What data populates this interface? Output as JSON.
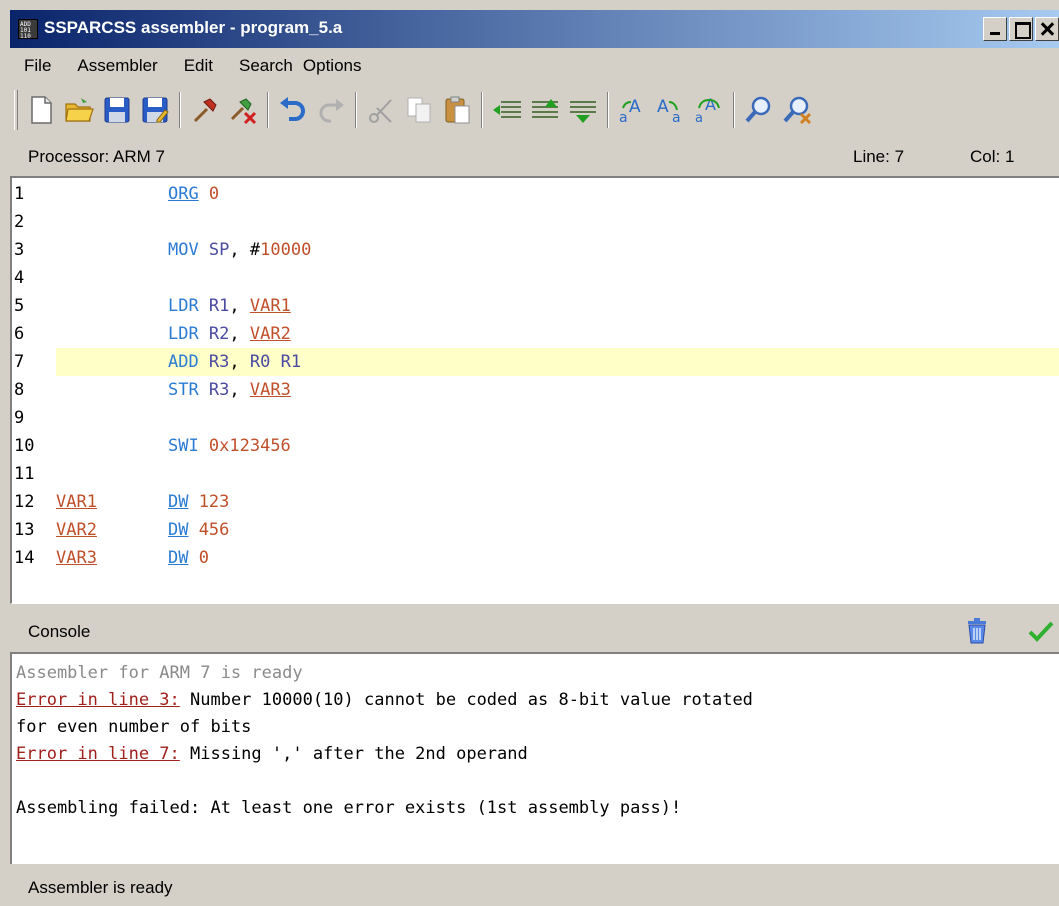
{
  "window": {
    "title": "SSPARCSS assembler - program_5.a",
    "app_icon_text": "ADD 101 110"
  },
  "menu": [
    "File",
    "Assembler",
    "Edit",
    "Search",
    "Options"
  ],
  "toolbar": {
    "icons": [
      "new-file-icon",
      "open-folder-icon",
      "save-icon",
      "save-as-icon",
      "assemble-icon",
      "clear-assemble-icon",
      "undo-icon",
      "redo-icon",
      "cut-icon",
      "copy-icon",
      "paste-icon",
      "indent-icon",
      "format-icon",
      "outdent-icon",
      "uppercase-icon",
      "lowercase-icon",
      "replace-case-icon",
      "find-icon",
      "find-replace-icon"
    ]
  },
  "info": {
    "processor": "Processor: ARM 7",
    "line": "Line: 7",
    "col": "Col: 1"
  },
  "editor": {
    "active_line": 7,
    "lines": [
      {
        "n": "1",
        "label": "",
        "op": "ORG",
        "op_kind": "dir",
        "args": [
          {
            "t": "0",
            "k": "num"
          }
        ]
      },
      {
        "n": "2",
        "label": "",
        "op": "",
        "op_kind": "",
        "args": []
      },
      {
        "n": "3",
        "label": "",
        "op": "MOV",
        "op_kind": "instr",
        "args": [
          {
            "t": "SP",
            "k": "reg"
          },
          {
            "t": ", ",
            "k": "punct"
          },
          {
            "t": "#",
            "k": "punct"
          },
          {
            "t": "10000",
            "k": "num"
          }
        ]
      },
      {
        "n": "4",
        "label": "",
        "op": "",
        "op_kind": "",
        "args": []
      },
      {
        "n": "5",
        "label": "",
        "op": "LDR",
        "op_kind": "instr",
        "args": [
          {
            "t": "R1",
            "k": "reg"
          },
          {
            "t": ", ",
            "k": "punct"
          },
          {
            "t": "VAR1",
            "k": "ref"
          }
        ]
      },
      {
        "n": "6",
        "label": "",
        "op": "LDR",
        "op_kind": "instr",
        "args": [
          {
            "t": "R2",
            "k": "reg"
          },
          {
            "t": ", ",
            "k": "punct"
          },
          {
            "t": "VAR2",
            "k": "ref"
          }
        ]
      },
      {
        "n": "7",
        "label": "",
        "op": "ADD",
        "op_kind": "instr",
        "args": [
          {
            "t": "R3",
            "k": "reg"
          },
          {
            "t": ", ",
            "k": "punct"
          },
          {
            "t": "R0",
            "k": "reg"
          },
          {
            "t": " ",
            "k": "punct"
          },
          {
            "t": "R1",
            "k": "reg"
          }
        ]
      },
      {
        "n": "8",
        "label": "",
        "op": "STR",
        "op_kind": "instr",
        "args": [
          {
            "t": "R3",
            "k": "reg"
          },
          {
            "t": ", ",
            "k": "punct"
          },
          {
            "t": "VAR3",
            "k": "ref"
          }
        ]
      },
      {
        "n": "9",
        "label": "",
        "op": "",
        "op_kind": "",
        "args": []
      },
      {
        "n": "10",
        "label": "",
        "op": "SWI",
        "op_kind": "instr",
        "args": [
          {
            "t": "0x123456",
            "k": "num"
          }
        ]
      },
      {
        "n": "11",
        "label": "",
        "op": "",
        "op_kind": "",
        "args": []
      },
      {
        "n": "12",
        "label": "VAR1",
        "op": "DW",
        "op_kind": "dir",
        "args": [
          {
            "t": "123",
            "k": "num"
          }
        ]
      },
      {
        "n": "13",
        "label": "VAR2",
        "op": "DW",
        "op_kind": "dir",
        "args": [
          {
            "t": "456",
            "k": "num"
          }
        ]
      },
      {
        "n": "14",
        "label": "VAR3",
        "op": "DW",
        "op_kind": "dir",
        "args": [
          {
            "t": "0",
            "k": "num"
          }
        ]
      }
    ]
  },
  "console": {
    "title": "Console",
    "lines": [
      [
        {
          "t": "Assembler for ARM 7 is ready",
          "k": "gray"
        }
      ],
      [
        {
          "t": "Error in line 3:",
          "k": "link"
        },
        {
          "t": " Number 10000(10) cannot be coded as 8-bit value rotated",
          "k": "text"
        }
      ],
      [
        {
          "t": "for even number of bits",
          "k": "text"
        }
      ],
      [
        {
          "t": "Error in line 7:",
          "k": "link"
        },
        {
          "t": " Missing ',' after the 2nd operand",
          "k": "text"
        }
      ],
      [],
      [
        {
          "t": "Assembling failed: At least one error exists (1st assembly pass)!",
          "k": "text"
        }
      ]
    ]
  },
  "status": {
    "text": "Assembler is ready"
  },
  "colors": {
    "title_gradient_start": "#0a246a",
    "title_gradient_end": "#a6caf0",
    "active_line": "#ffffc8",
    "error_link": "#a0201c",
    "label": "#c0502a",
    "keyword": "#2a7bd4"
  }
}
